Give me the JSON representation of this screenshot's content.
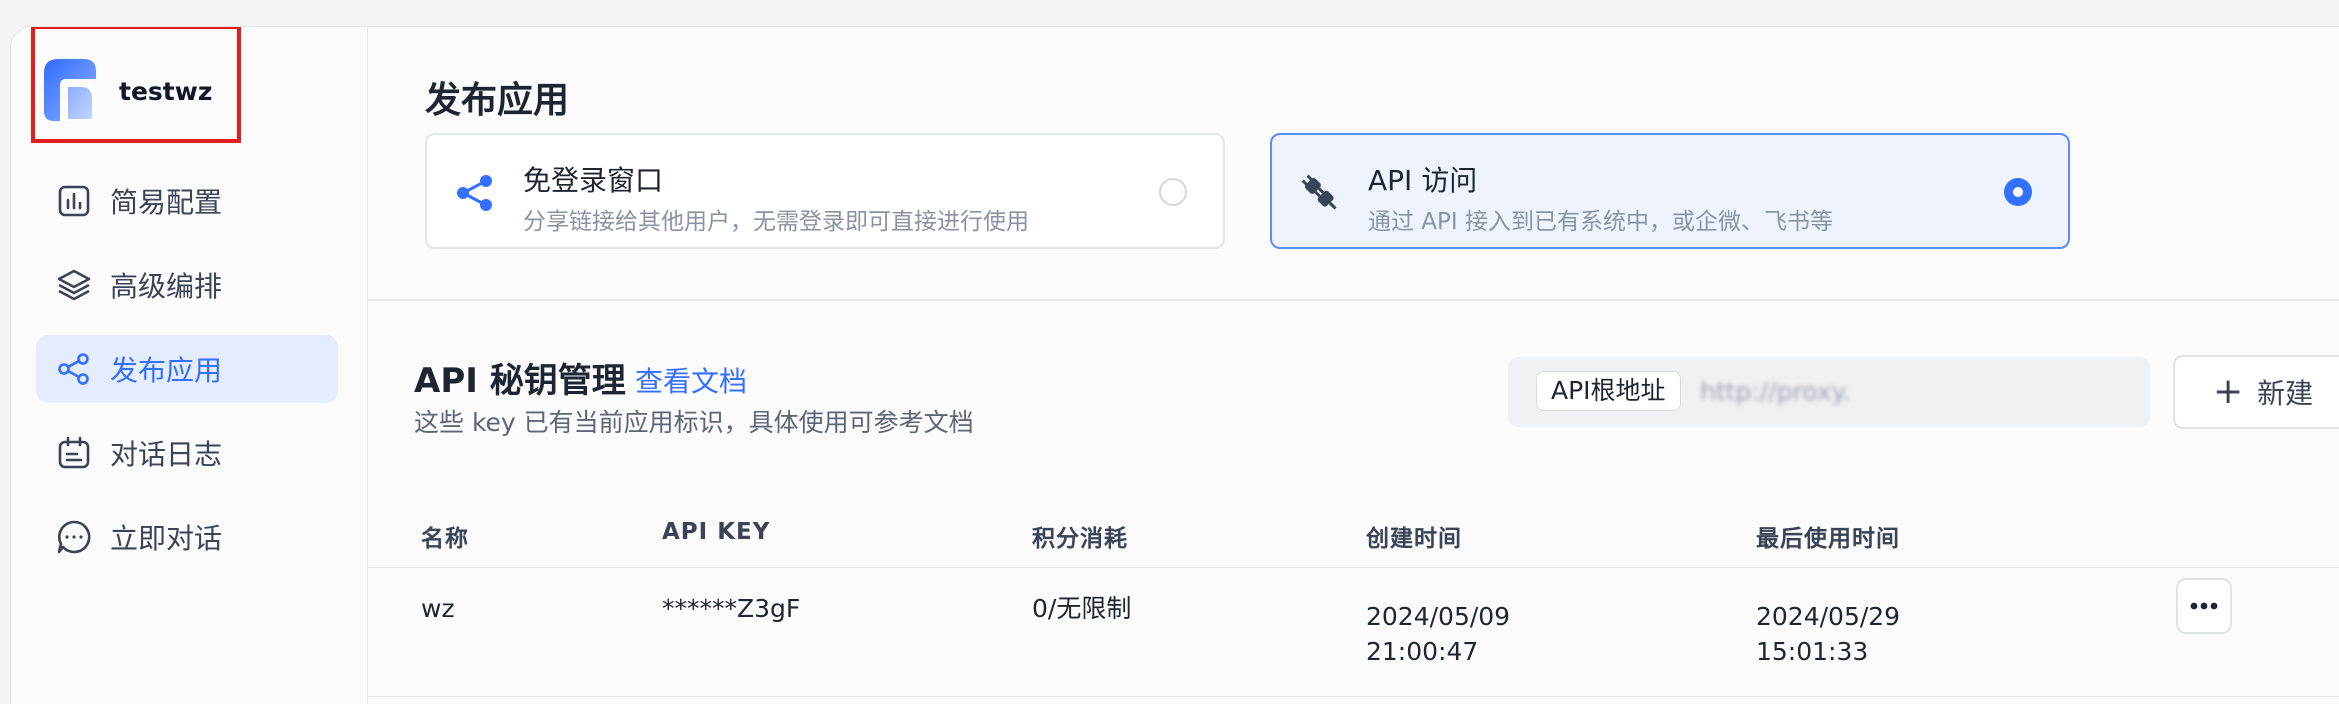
{
  "app": {
    "name": "testwz"
  },
  "nav": {
    "items": [
      {
        "label": "简易配置",
        "icon": "bar-chart-icon"
      },
      {
        "label": "高级编排",
        "icon": "layers-icon"
      },
      {
        "label": "发布应用",
        "icon": "share-icon",
        "active": true
      },
      {
        "label": "对话日志",
        "icon": "calendar-log-icon"
      },
      {
        "label": "立即对话",
        "icon": "chat-bubble-icon"
      }
    ]
  },
  "publish": {
    "title": "发布应用",
    "options": [
      {
        "title": "免登录窗口",
        "desc": "分享链接给其他用户，无需登录即可直接进行使用",
        "icon": "share-icon",
        "selected": false
      },
      {
        "title": "API 访问",
        "desc": "通过 API 接入到已有系统中，或企微、飞书等",
        "icon": "plug-icon",
        "selected": true
      }
    ]
  },
  "api_keys": {
    "title": "API 秘钥管理",
    "doc_link": "查看文档",
    "desc": "这些 key 已有当前应用标识，具体使用可参考文档",
    "base_url_label": "API根地址",
    "base_url": "http://proxy.",
    "new_button": "新建",
    "columns": [
      "名称",
      "API KEY",
      "积分消耗",
      "创建时间",
      "最后使用时间"
    ],
    "rows": [
      {
        "name": "wz",
        "key": "******Z3gF",
        "usage": "0/无限制",
        "created_date": "2024/05/09",
        "created_time": "21:00:47",
        "last_used_date": "2024/05/29",
        "last_used_time": "15:01:33"
      }
    ]
  },
  "colors": {
    "accent": "#3370ff",
    "active_bg": "#e5ecfd",
    "highlight_border": "#e11d1d"
  }
}
